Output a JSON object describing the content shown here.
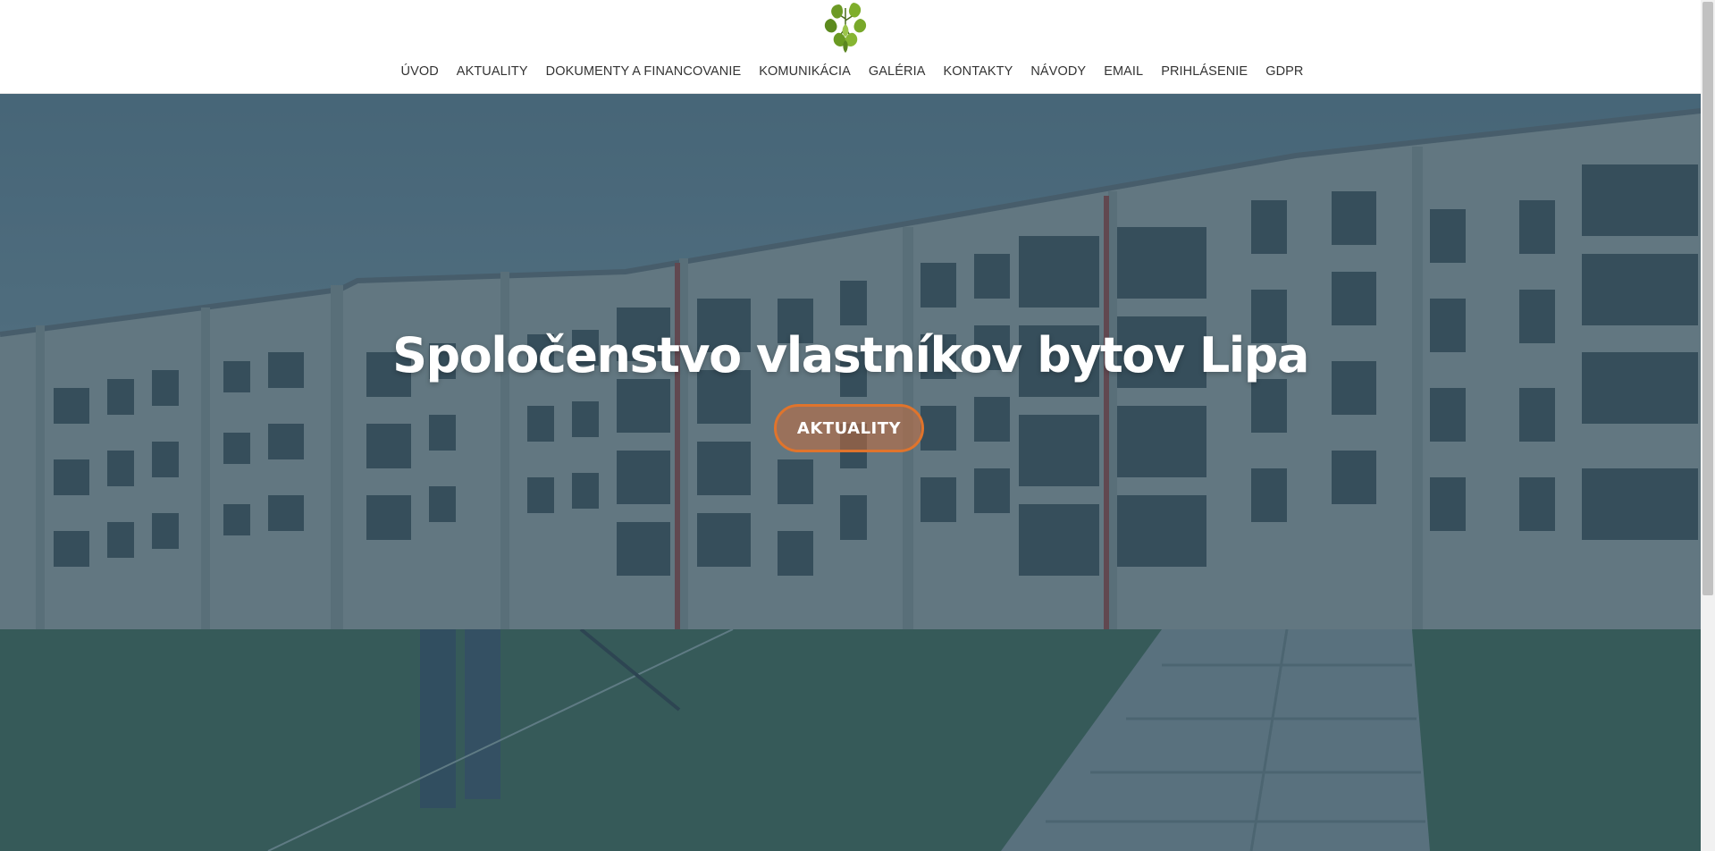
{
  "site": {
    "logo_icon": "linden-leaf-logo"
  },
  "nav": {
    "items": [
      {
        "label": "ÚVOD"
      },
      {
        "label": "AKTUALITY"
      },
      {
        "label": "DOKUMENTY A FINANCOVANIE"
      },
      {
        "label": "KOMUNIKÁCIA"
      },
      {
        "label": "GALÉRIA"
      },
      {
        "label": "KONTAKTY"
      },
      {
        "label": "NÁVODY"
      },
      {
        "label": "EMAIL"
      },
      {
        "label": "PRIHLÁSENIE"
      },
      {
        "label": "GDPR"
      }
    ]
  },
  "hero": {
    "title": "Spoločenstvo vlastníkov bytov Lipa",
    "button_label": "AKTUALITY"
  },
  "colors": {
    "accent": "#e0742c",
    "overlay_blue": "#2f5a73",
    "text": "#333333"
  }
}
